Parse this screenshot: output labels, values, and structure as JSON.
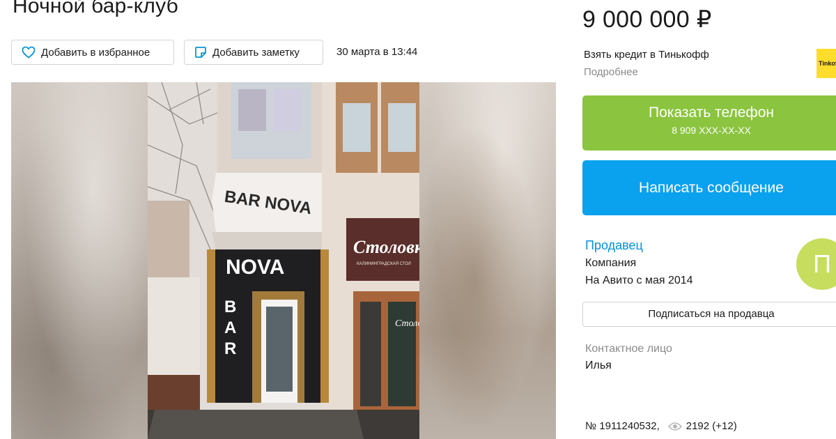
{
  "listing": {
    "title": "Ночной бар-клуб",
    "price": "9 000 000 ₽",
    "date": "30 марта в 13:44",
    "id_text": "№ 1911240532,",
    "views": "2192 (+12)"
  },
  "actions": {
    "favorite_label": "Добавить в избранное",
    "note_label": "Добавить заметку"
  },
  "photo": {
    "sign_top": "BAR NOVA",
    "sign_main": "NOVA",
    "sign_vertical": [
      "B",
      "A",
      "R"
    ],
    "sign_shop": "Столовк",
    "sign_shop_sub": "КАЛИНИНГРАДСКАЯ СТОЛ",
    "sign_door": "Столо"
  },
  "credit": {
    "text": "Взять кредит в Тинькофф",
    "more": "Подробнее",
    "logo_text": "Tinkoff"
  },
  "contact_buttons": {
    "phone_label": "Показать телефон",
    "phone_number": "8 909 XXX-XX-XX",
    "message_label": "Написать сообщение"
  },
  "seller": {
    "link_label": "Продавец",
    "type": "Компания",
    "since": "На Авито с мая 2014",
    "avatar_letter": "П",
    "subscribe_label": "Подписаться на продавца"
  },
  "contact_person": {
    "label": "Контактное лицо",
    "name": "Илья"
  },
  "colors": {
    "phone_button": "#8bc43f",
    "message_button": "#0aa1ef",
    "seller_link": "#0091d9",
    "avatar": "#c6dd5e",
    "tinkoff_yellow": "#ffdd2d"
  },
  "icons": {
    "favorite": "heart-icon",
    "note": "note-icon",
    "views": "eye-icon"
  }
}
